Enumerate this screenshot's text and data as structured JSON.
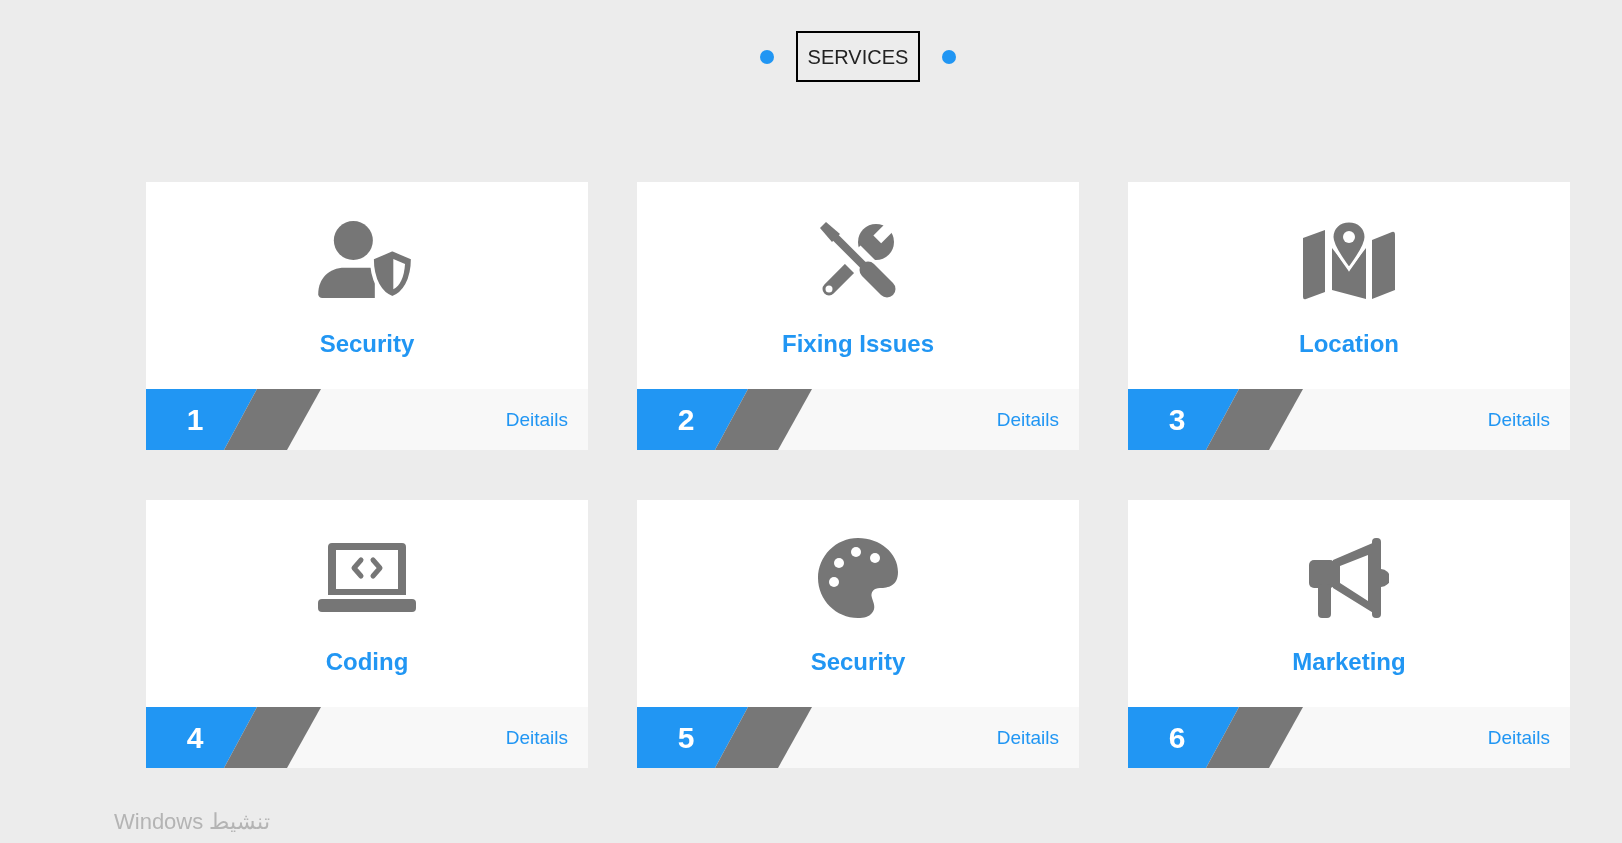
{
  "header": {
    "title": "SERVICES"
  },
  "services": [
    {
      "kind": "security",
      "title": "Security",
      "number": "1",
      "link": "Deitails"
    },
    {
      "kind": "tools",
      "title": "Fixing Issues",
      "number": "2",
      "link": "Deitails"
    },
    {
      "kind": "map",
      "title": "Location",
      "number": "3",
      "link": "Deitails"
    },
    {
      "kind": "code",
      "title": "Coding",
      "number": "4",
      "link": "Deitails"
    },
    {
      "kind": "palette",
      "title": "Security",
      "number": "5",
      "link": "Deitails"
    },
    {
      "kind": "megaphone",
      "title": "Marketing",
      "number": "6",
      "link": "Deitails"
    }
  ],
  "system_notice": "تنشيط Windows"
}
